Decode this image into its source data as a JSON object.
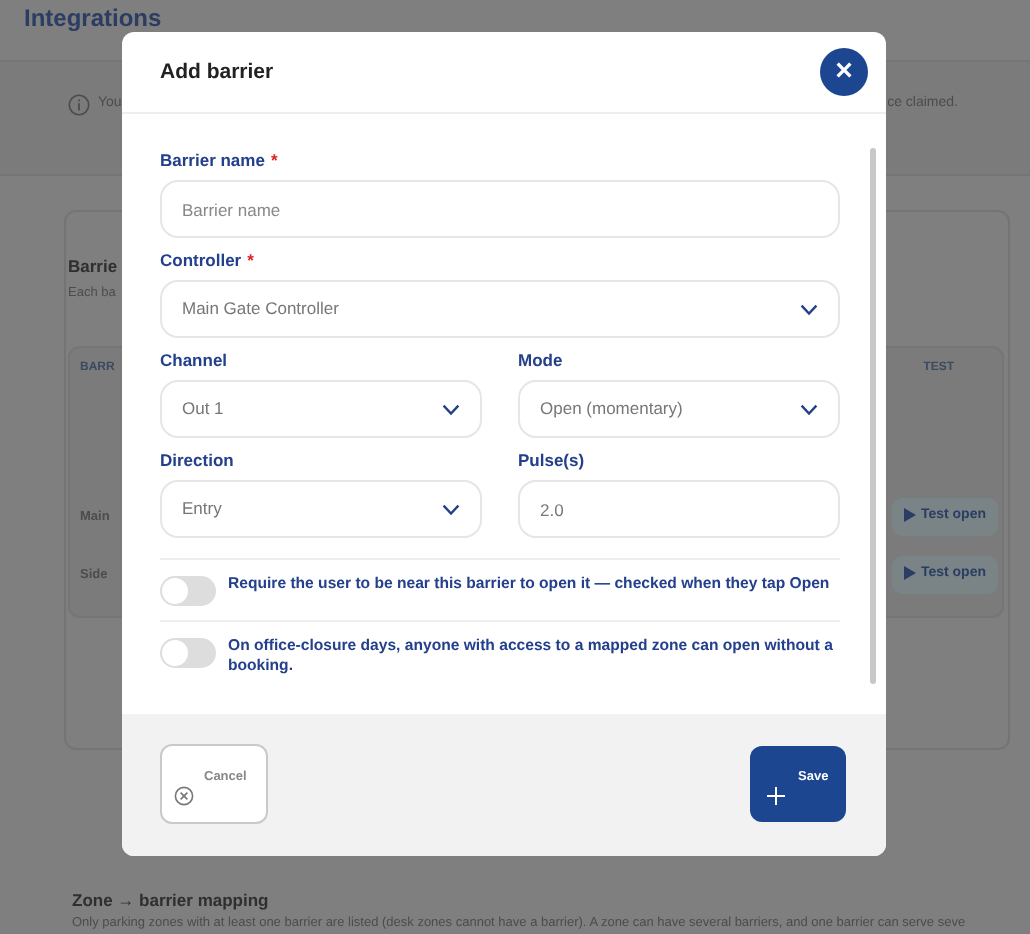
{
  "page": {
    "title": "Integrations",
    "info_left": "You",
    "info_right": "ce claimed.",
    "section_title": "Barrie",
    "section_desc": "Each ba",
    "table": {
      "columns": [
        "BARR",
        "TEST"
      ],
      "rows": [
        {
          "name": "Main",
          "action": "Test open"
        },
        {
          "name": "Side",
          "action": "Test open"
        }
      ]
    },
    "mapping_title": "Zone → barrier mapping",
    "mapping_desc": "Only parking zones with at least one barrier are listed (desk zones cannot have a barrier). A zone can have several barriers, and one barrier can serve seve"
  },
  "dialog": {
    "title": "Add barrier",
    "close": "×",
    "fields": [
      {
        "kind": "text",
        "label": "Barrier name",
        "required_mark": "*",
        "placeholder": "Barrier name",
        "wide": true
      },
      {
        "kind": "select",
        "label": "Controller",
        "required_mark": "*",
        "value": "Main Gate Controller",
        "wide": true
      },
      {
        "kind": "select",
        "label": "Channel",
        "value": "Out 1",
        "wide": false
      },
      {
        "kind": "select",
        "label": "Mode",
        "value": "Open (momentary)",
        "wide": false
      },
      {
        "kind": "select",
        "label": "Direction",
        "value": "Entry",
        "wide": false
      },
      {
        "kind": "text",
        "label": "Pulse(s)",
        "value": "2.0",
        "wide": false
      }
    ],
    "toggles": [
      {
        "label": "Require the user to be near this barrier to open it — checked when they tap Open",
        "on": false
      },
      {
        "label": "On office-closure days, anyone with access to a mapped zone can open without a booking.",
        "on": false
      }
    ],
    "cancel": "Cancel",
    "save": "Save"
  }
}
